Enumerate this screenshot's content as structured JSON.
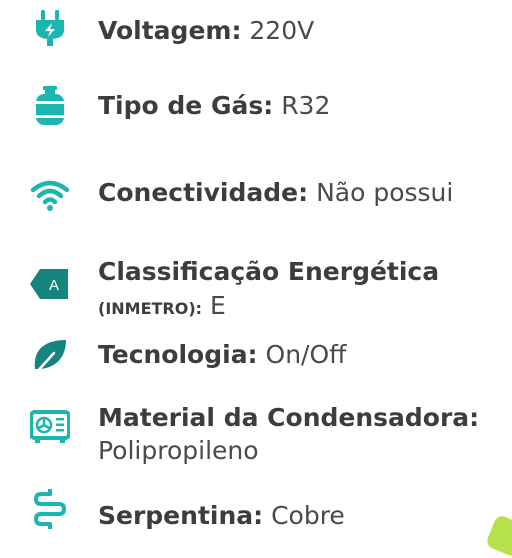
{
  "specs": [
    {
      "icon": "power-plug-icon",
      "label": "Voltagem:",
      "value": "220V"
    },
    {
      "icon": "gas-cylinder-icon",
      "label": "Tipo de Gás:",
      "value": "R32"
    },
    {
      "icon": "wifi-icon",
      "label": "Conectividade:",
      "value": "Não possui"
    },
    {
      "icon": "energy-class-icon",
      "icon_text": "A",
      "label": "Classificação Energética",
      "sublabel": "(INMETRO):",
      "value": "E"
    },
    {
      "icon": "leaf-icon",
      "label": "Tecnologia:",
      "value": "On/Off"
    },
    {
      "icon": "condenser-unit-icon",
      "label": "Material da Condensadora:",
      "value": "Polipropileno"
    },
    {
      "icon": "coil-icon",
      "label": "Serpentina:",
      "value": "Cobre"
    }
  ],
  "colors": {
    "icon_teal": "#1cb5b0",
    "icon_dark_teal": "#16857f",
    "text": "#3d3d3d",
    "accent_green": "#b6e24a"
  }
}
